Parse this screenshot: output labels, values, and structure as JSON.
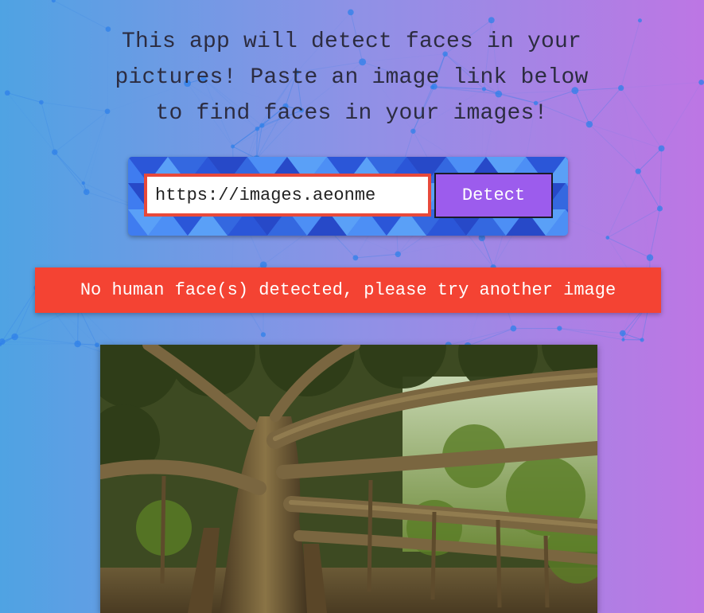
{
  "intro": {
    "lines": [
      "This app will detect faces in your",
      "pictures! Paste an image link below",
      "to find faces in your images!"
    ]
  },
  "form": {
    "url_value": "https://images.aeonme",
    "detect_label": "Detect"
  },
  "status": {
    "error_message": "No human face(s) detected, please try another image"
  },
  "colors": {
    "bg_left": "#4fa3e3",
    "bg_right": "#bd76e4",
    "card_blue": "#3f7cf0",
    "button_purple": "#9c5ced",
    "error_red": "#f44333",
    "input_border": "#e8493a"
  },
  "icons": {
    "background": "particle-network",
    "photo": "banyan-tree-forest-photo"
  }
}
